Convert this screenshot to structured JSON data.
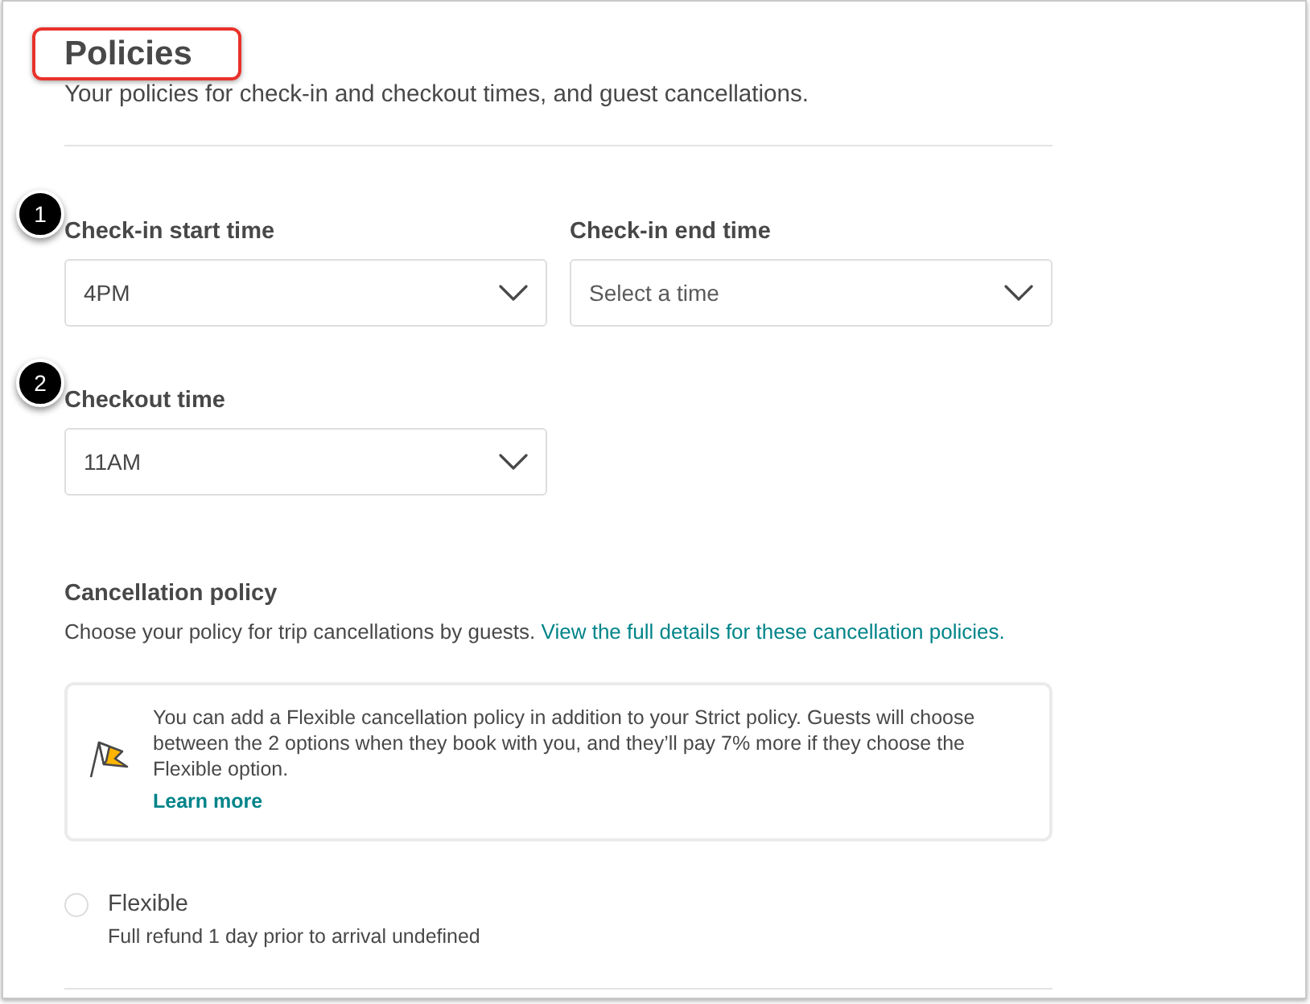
{
  "header": {
    "title": "Policies",
    "highlighted": true,
    "subtitle": "Your policies for check-in and checkout times, and guest cancellations."
  },
  "time_rows": [
    {
      "callout": "1",
      "fields": [
        {
          "label": "Check-in start time",
          "value": "4PM"
        },
        {
          "label": "Check-in end time",
          "placeholder": "Select a time"
        }
      ]
    },
    {
      "callout": "2",
      "fields": [
        {
          "label": "Checkout time",
          "value": "11AM"
        }
      ]
    }
  ],
  "cancellation": {
    "title": "Cancellation policy",
    "description": "Choose your policy for trip cancellations by guests.",
    "details_link": "View the full details for these cancellation policies.",
    "notice": {
      "text": "You can add a Flexible cancellation policy in addition to your Strict policy. Guests will choose between the 2 options when they book with you, and they’ll pay 7% more if they choose the Flexible option.",
      "link": "Learn more"
    },
    "options": [
      {
        "label": "Flexible",
        "description": "Full refund 1 day prior to arrival undefined",
        "selected": false
      }
    ]
  }
}
